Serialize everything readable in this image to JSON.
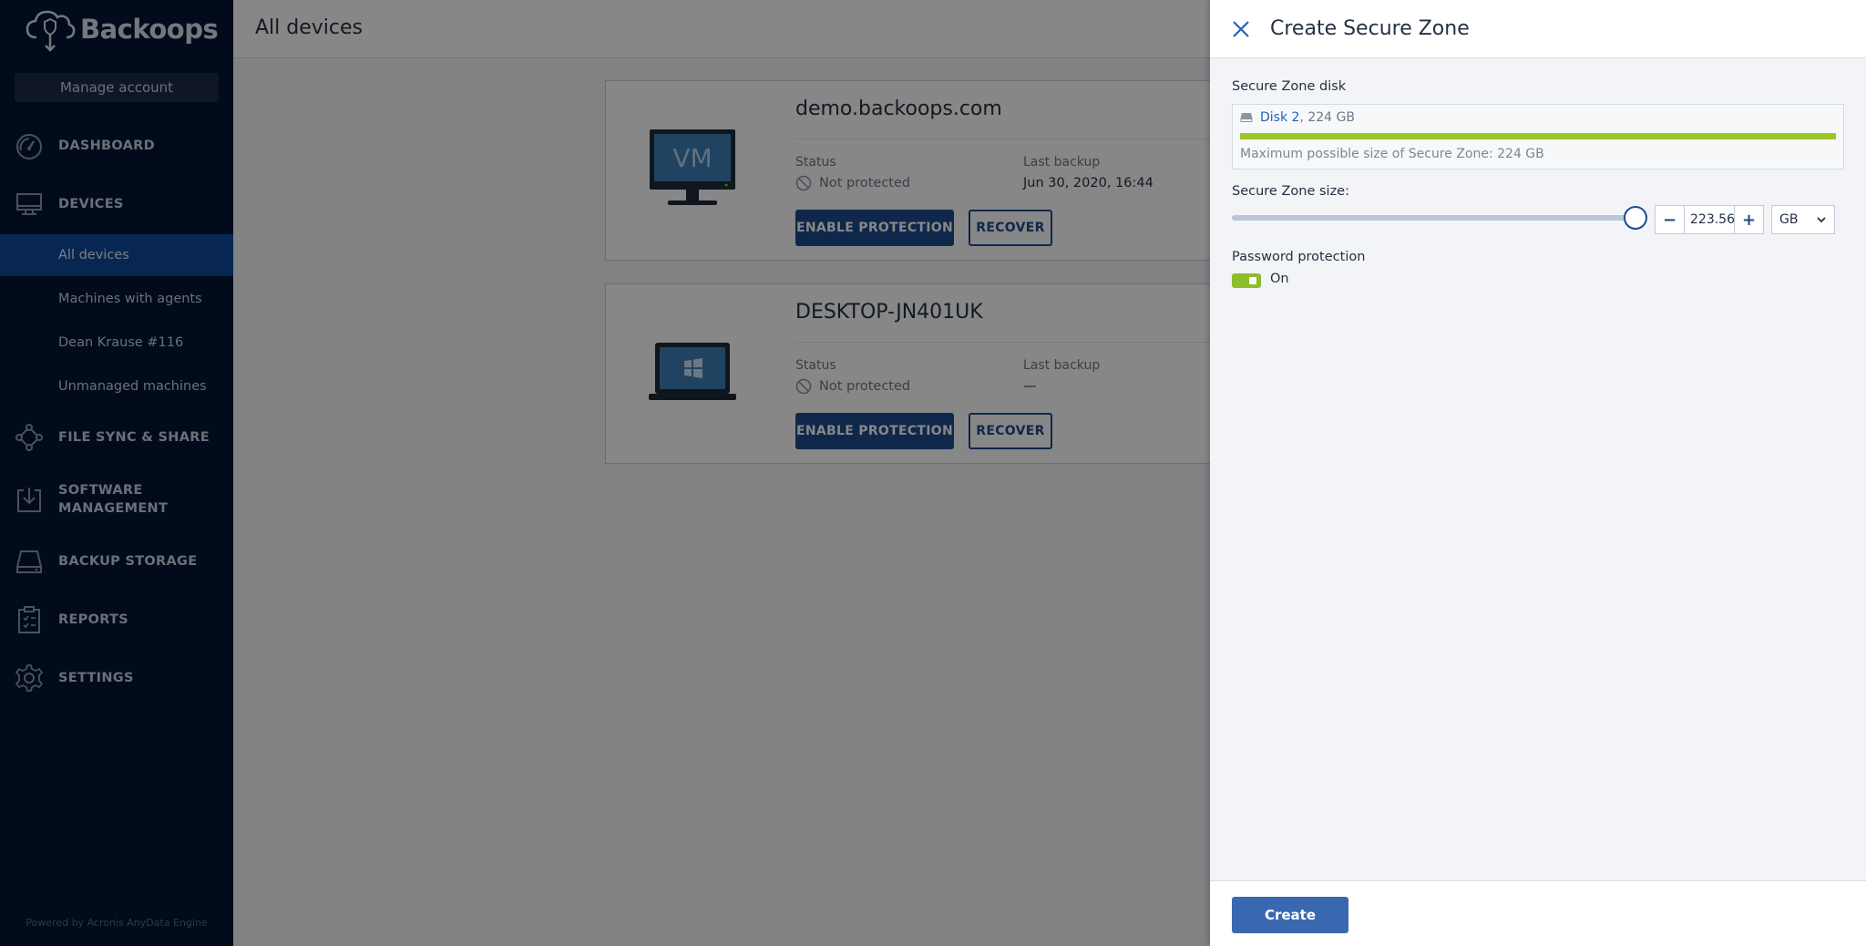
{
  "sidebar": {
    "brand": "Backoops",
    "manage_account": "Manage account",
    "nav": {
      "dashboard": "DASHBOARD",
      "devices": "DEVICES",
      "file_sync": "FILE SYNC & SHARE",
      "software_line1": "SOFTWARE",
      "software_line2": "MANAGEMENT",
      "backup_storage": "BACKUP STORAGE",
      "reports": "REPORTS",
      "settings": "SETTINGS"
    },
    "sub_items": {
      "all_devices": "All devices",
      "machines_with_agents": "Machines with agents",
      "dean_krause": "Dean Krause #116",
      "unmanaged": "Unmanaged machines"
    },
    "powered_by": "Powered by Acronis AnyData Engine"
  },
  "main": {
    "title": "All devices",
    "devices": [
      {
        "name": "demo.backoops.com",
        "type_label": "VM",
        "status_label": "Status",
        "status": "Not protected",
        "last_backup_label": "Last backup",
        "last_backup": "Jun 30, 2020, 16:44",
        "enable_label": "ENABLE PROTECTION",
        "recover_label": "RECOVER"
      },
      {
        "name": "DESKTOP-JN401UK",
        "status_label": "Status",
        "status": "Not protected",
        "last_backup_label": "Last backup",
        "last_backup": "—",
        "enable_label": "ENABLE PROTECTION",
        "recover_label": "RECOVER"
      }
    ]
  },
  "panel": {
    "title": "Create Secure Zone",
    "disk_section_label": "Secure Zone disk",
    "disk_name": "Disk 2",
    "disk_size": ", 224 GB",
    "disk_usage_fraction": 1.0,
    "max_size_text": "Maximum possible size of Secure Zone: 224 GB",
    "size_label": "Secure Zone size:",
    "slider_fraction": 0.997,
    "size_value": "223.56",
    "minus": "−",
    "plus": "+",
    "unit": "GB",
    "password_label": "Password protection",
    "password_state": "On",
    "create_label": "Create"
  },
  "colors": {
    "sidebar_bg": "#031535",
    "active_item": "#0f4b9b",
    "primary": "#1d4b8f",
    "accent_green": "#9bc62b",
    "create_button": "#3a68b0"
  }
}
